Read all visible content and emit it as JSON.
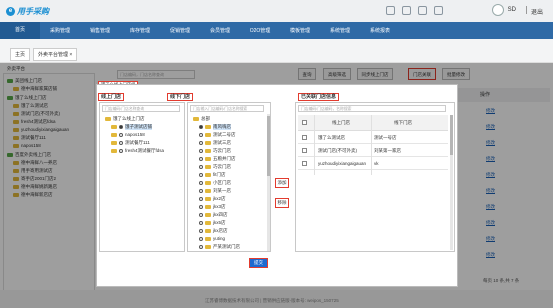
{
  "header": {
    "logo_text": "用手采购",
    "logo_mark": "e",
    "user": "SD",
    "logout": "退出"
  },
  "nav": [
    "首页",
    "采购管理",
    "销售管理",
    "库存管理",
    "促销管理",
    "会员管理",
    "O2O管理",
    "模板管理",
    "系统管理",
    "系统报表"
  ],
  "tabs": [
    {
      "label": "主页"
    },
    {
      "label": "外卖平台管理 ×"
    }
  ],
  "background": {
    "panel_title": "外卖平台",
    "search_placeholder": "门店编码，门店名称查询",
    "buttons": [
      "查询",
      "高级筛选",
      "同步线上门店",
      "门店关联",
      "批量修改"
    ],
    "tree": [
      "美团线上门店",
      "德中海鲜家属店铺",
      "饿了么线上门店",
      "饿了么测试店",
      "测试门店(不可外卖)",
      "fresh4测试店fdsa",
      "yuzhoudiyixiangaigauan",
      "测试餐厅111",
      "napos158",
      "百度外卖线上门店",
      "德中海鲜八一养店",
      "用手寄用测试店",
      "寄手店2001门店2",
      "德中海鲜姚新路店",
      "德中海鲜新店店"
    ],
    "table_header": "操作",
    "links": [
      "修改",
      "修改",
      "修改",
      "修改",
      "修改",
      "修改",
      "修改",
      "修改",
      "修改",
      "修改"
    ],
    "pager": "每页 10 条,共 7 条",
    "footer": "江苏睿博数据技术有限公司 | 营销供应链版-版本号: weipos_150725"
  },
  "modal": {
    "top_note": "饿了么线上门店组",
    "online_label": "线上门店",
    "offline_label": "线下门店",
    "linked_label": "已关联门店信息",
    "online_search_placeholder": "门店编码/门店名称查询",
    "offline_search_placeholder": "门店输入门店编码/门店名称搜索",
    "linked_search_placeholder": "门店编码/门店编码，名称搜索",
    "online_tree": [
      "饿了么线上门店",
      "饿子测试店铺",
      "napos158",
      "测试餐厅111",
      "fresh4测试餐厅fdsa"
    ],
    "offline_tree": [
      "总部",
      "南风嗨店",
      "测试二号店",
      "测试三店",
      "巧云门店",
      "五粮井门店",
      "巧云门店",
      "fit门店",
      "小区门店",
      "刘某一店",
      "jkx2店",
      "jkx3店",
      "jkx四店",
      "jkx5店",
      "jkx店店",
      "yuting",
      "严某测试门店"
    ],
    "add_button": "添加",
    "remove_button": "移除",
    "submit_button": "提交",
    "linked_headers": [
      "线上门店",
      "线下门店"
    ],
    "linked_rows": [
      {
        "online": "饿了么测试店",
        "offline": "测试一号店"
      },
      {
        "online": "测试门店(不可外卖)",
        "offline": "刘某第一家店"
      },
      {
        "online": "yuzhoudiyixiangaigauan",
        "offline": "vk"
      }
    ]
  }
}
